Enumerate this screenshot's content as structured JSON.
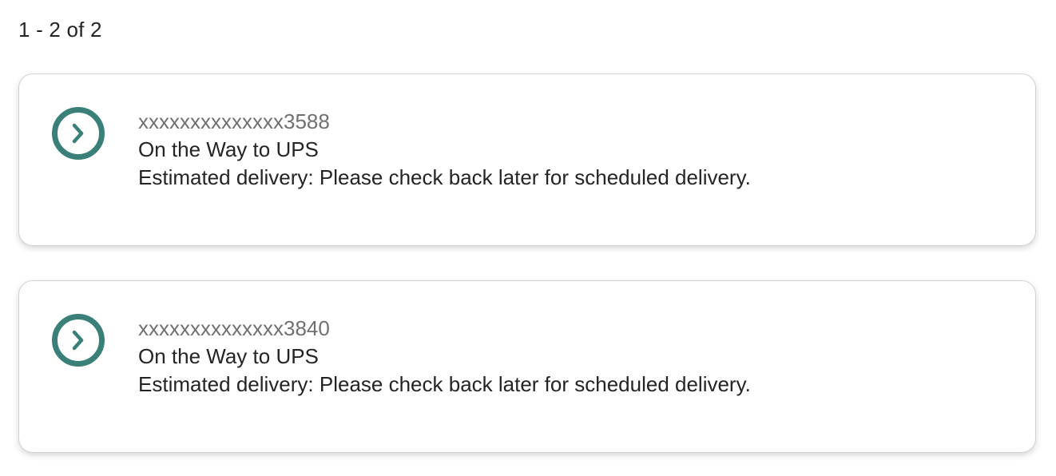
{
  "results": {
    "count_label": "1 - 2 of 2"
  },
  "colors": {
    "accent": "#3a8079",
    "card_border": "#d2d2d2",
    "muted_text": "#707070",
    "text": "#242424"
  },
  "shipments": [
    {
      "icon": "chevron-right-circle-icon",
      "tracking_number": "xxxxxxxxxxxxxx3588",
      "status": "On the Way to UPS",
      "estimated_delivery": "Estimated delivery: Please check back later for scheduled delivery."
    },
    {
      "icon": "chevron-right-circle-icon",
      "tracking_number": "xxxxxxxxxxxxxx3840",
      "status": "On the Way to UPS",
      "estimated_delivery": "Estimated delivery: Please check back later for scheduled delivery."
    }
  ]
}
